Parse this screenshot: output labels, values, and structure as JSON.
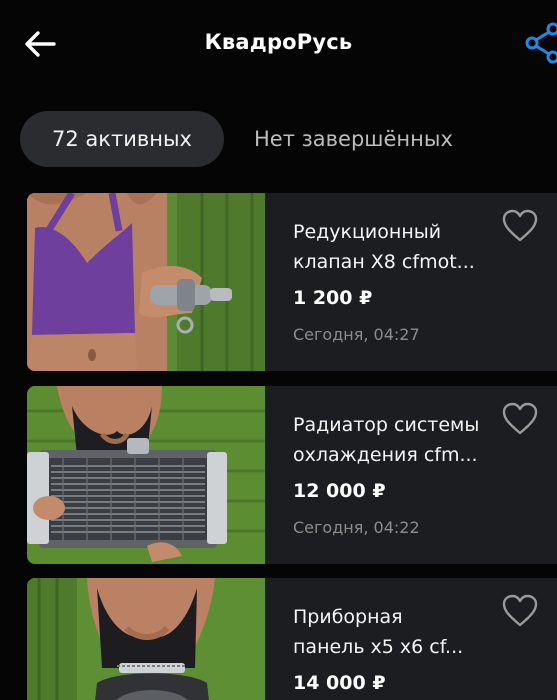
{
  "header": {
    "title": "КвадроРусь",
    "back_icon": "arrow-left-icon",
    "share_icon": "share-icon"
  },
  "tabs": {
    "active_label": "72 активных",
    "inactive_label": "Нет завершённых"
  },
  "listings": [
    {
      "title": "Редукционный\nклапан X8 cfmot...",
      "price": "1 200 ₽",
      "date": "Сегодня, 04:27",
      "favorite_icon": "heart-outline-icon"
    },
    {
      "title": "Радиатор системы\nохлаждения cfm...",
      "price": "12 000 ₽",
      "date": "Сегодня, 04:22",
      "favorite_icon": "heart-outline-icon"
    },
    {
      "title": "Приборная\nпанель x5 x6 cf...",
      "price": "14 000 ₽",
      "date": "",
      "favorite_icon": "heart-outline-icon"
    }
  ],
  "colors": {
    "background": "#050505",
    "card": "#1c1d20",
    "active_tab": "#2a2c30",
    "share_accent": "#1f8ae6",
    "muted_text": "#8c8c8c"
  }
}
